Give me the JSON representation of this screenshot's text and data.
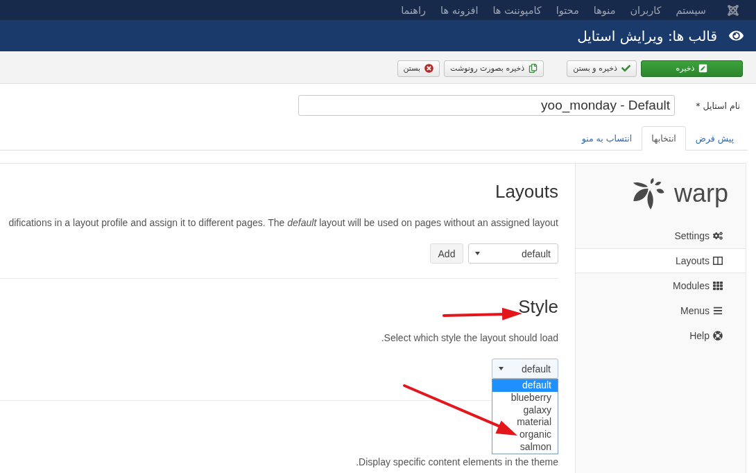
{
  "top_menu": {
    "items": [
      "سیستم",
      "کاربران",
      "منوها",
      "محتوا",
      "کامپوننت ها",
      "افزونه ها",
      "راهنما"
    ]
  },
  "page_title": "قالب ها: ویرایش استایل",
  "toolbar": {
    "buttons": [
      {
        "label": "ذخیره",
        "kind": "primary"
      },
      {
        "label": "ذخیره و بستن",
        "kind": "default"
      },
      {
        "label": "ذخیره بصورت رونوشت",
        "kind": "default"
      },
      {
        "label": "بستن",
        "kind": "default"
      }
    ]
  },
  "style_name": {
    "label": "نام استایل *",
    "value": "yoo_monday - Default"
  },
  "tabs": [
    {
      "label": "پیش فرض",
      "selected": false
    },
    {
      "label": "انتخابها",
      "selected": true
    },
    {
      "label": "انتساب به منو",
      "selected": false
    }
  ],
  "sidebar": {
    "logo_text": "warp",
    "items": [
      {
        "label": "Settings",
        "selected": false
      },
      {
        "label": "Layouts",
        "selected": true
      },
      {
        "label": "Modules",
        "selected": false
      },
      {
        "label": "Menus",
        "selected": false
      },
      {
        "label": "Help",
        "selected": false
      }
    ]
  },
  "sections": [
    {
      "title": "Layouts",
      "description": "difications in a layout profile and assign it to different pages. The *default* layout will be used on pages without an assigned layout",
      "add_button": "Add",
      "select": {
        "value": "default",
        "expanded": false
      }
    },
    {
      "title": "Style",
      "description": ".Select which style the layout should load",
      "select": {
        "value": "default",
        "expanded": true,
        "options": [
          {
            "label": "default",
            "selected": true
          },
          {
            "label": "blueberry",
            "selected": false
          },
          {
            "label": "galaxy",
            "selected": false
          },
          {
            "label": "material",
            "selected": false
          },
          {
            "label": "organic",
            "selected": false
          },
          {
            "label": "salmon",
            "selected": false
          }
        ]
      }
    },
    {
      "description": ".Display specific content elements in the theme"
    }
  ]
}
